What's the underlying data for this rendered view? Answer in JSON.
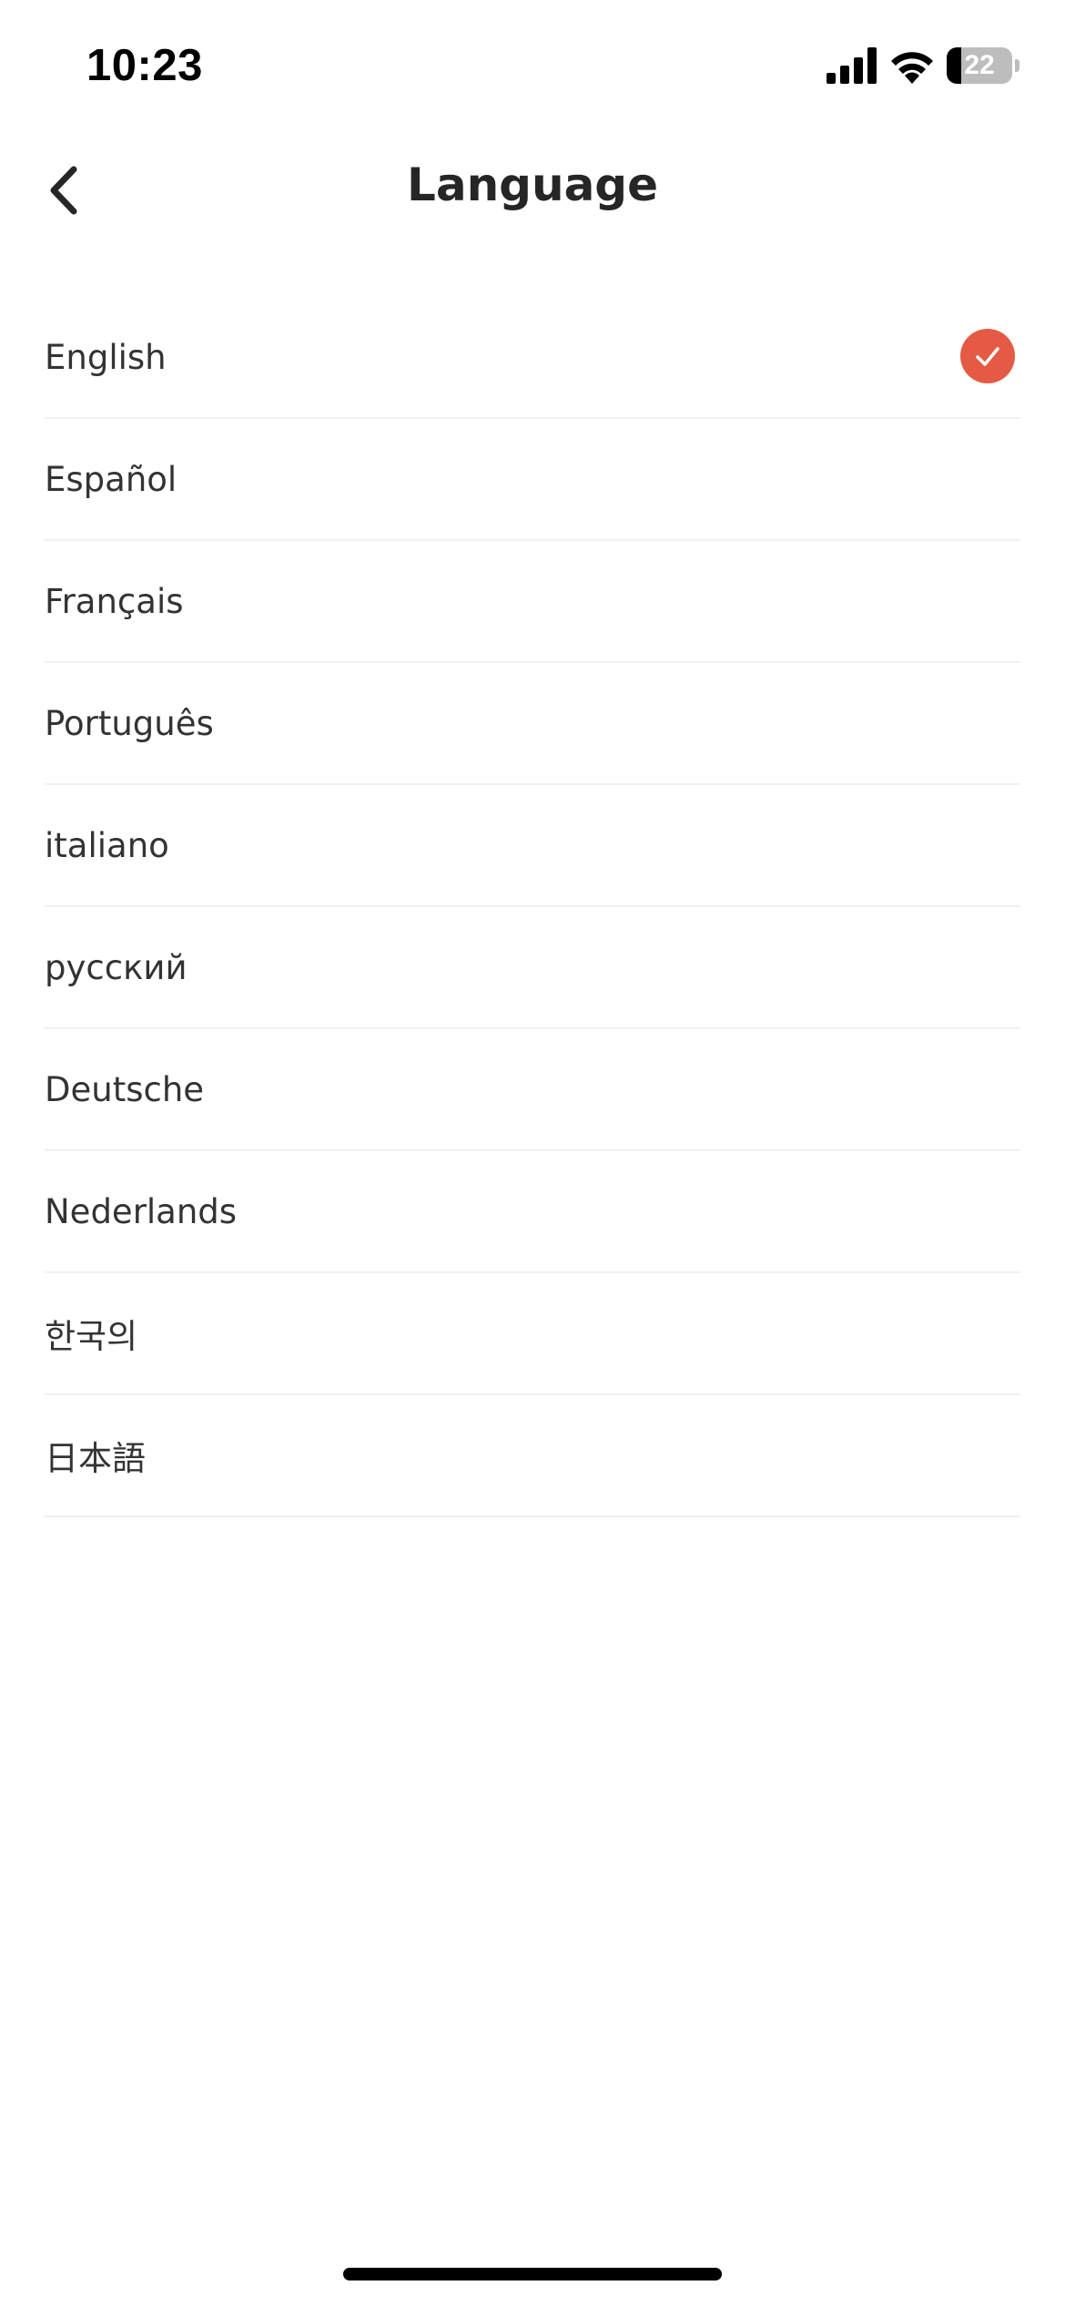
{
  "status_bar": {
    "time": "10:23",
    "battery_level": "22",
    "battery_fraction": 0.22
  },
  "header": {
    "title": "Language",
    "back_icon": "chevron-left-icon"
  },
  "languages": [
    {
      "label": "English",
      "selected": true
    },
    {
      "label": "Español",
      "selected": false
    },
    {
      "label": "Français",
      "selected": false
    },
    {
      "label": "Português",
      "selected": false
    },
    {
      "label": "italiano",
      "selected": false
    },
    {
      "label": "русский",
      "selected": false
    },
    {
      "label": "Deutsche",
      "selected": false
    },
    {
      "label": "Nederlands",
      "selected": false
    },
    {
      "label": "한국의",
      "selected": false
    },
    {
      "label": "日本語",
      "selected": false
    }
  ],
  "colors": {
    "accent": "#e45a45",
    "text": "#333333",
    "divider": "#f1f1f1"
  }
}
